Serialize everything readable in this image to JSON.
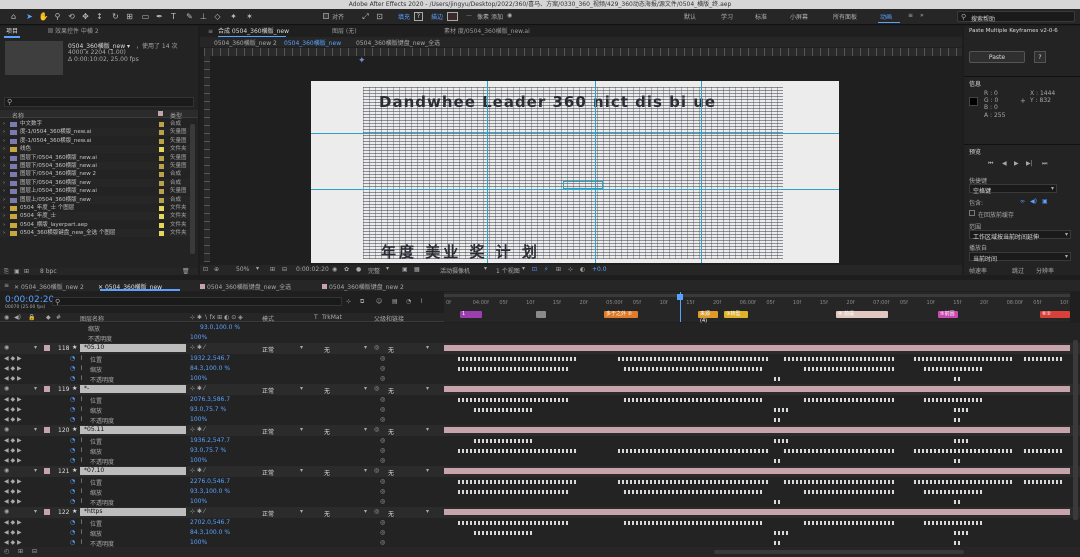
{
  "app": {
    "title": "Adobe After Effects 2020 - /Users/jingyu/Desktop/2022/360/喜马、方案/0330_360_视频/429_360动态海报/源文件/0504_横版_终.aep"
  },
  "toolbar": {
    "snap_label": "对齐",
    "fill_label": "填充",
    "stroke_label": "描边",
    "pixel_label": "像素",
    "add_label": "添加",
    "workspaces": [
      "默认",
      "学习",
      "标准",
      "小屏幕",
      "所有面板",
      "动画"
    ],
    "active_workspace": "动画",
    "search_placeholder": "搜索帮助"
  },
  "project": {
    "tabs": [
      "项目",
      "效果控件 中横 2"
    ],
    "item_name": "0504_360横版_new ▾",
    "used": "，使用了 14 次",
    "size": "4000 x 2204 (1.00)",
    "duration": "Δ 0:00:10:02, 25.00 fps",
    "search_placeholder": "",
    "col_name": "名称",
    "col_type": "类型",
    "items": [
      {
        "name": "中文数字",
        "type": "合成",
        "color": "#b9a24a"
      },
      {
        "name": "度-1/0504_360横版_new.ai",
        "type": "矢量图",
        "color": "#b9a24a"
      },
      {
        "name": "度-1/0504_360横版_new.ai",
        "type": "矢量图",
        "color": "#b9a24a"
      },
      {
        "name": "线色",
        "type": "文件夹",
        "color": "#e4d65a"
      },
      {
        "name": "图层下/0504_360横版_new.ai",
        "type": "矢量图",
        "color": "#b9a24a"
      },
      {
        "name": "图层下/0504_360横版_new.ai",
        "type": "矢量图",
        "color": "#b9a24a"
      },
      {
        "name": "图层下/0504_360横版_new 2",
        "type": "合成",
        "color": "#b9a24a"
      },
      {
        "name": "图层下/0504_360横版_new",
        "type": "合成",
        "color": "#b9a24a"
      },
      {
        "name": "图层上/0504_360横版_new.ai",
        "type": "矢量图",
        "color": "#b9a24a"
      },
      {
        "name": "图层上/0504_360横版_new",
        "type": "合成",
        "color": "#b9a24a"
      },
      {
        "name": "0504_年度_士 个图层",
        "type": "文件夹",
        "color": "#e4d65a"
      },
      {
        "name": "0504_年度_士",
        "type": "文件夹",
        "color": "#e4d65a"
      },
      {
        "name": "0504_横版_layerpart.aep",
        "type": "文件夹",
        "color": "#e4d65a"
      },
      {
        "name": "0504_360横版键盘_new_全选 个图层",
        "type": "文件夹",
        "color": "#e4d65a"
      }
    ],
    "bpc": "8 bpc"
  },
  "viewer": {
    "tabs": [
      "合成 0504_360横版_new",
      "图层 (无)",
      "素材 度/0504_360横版_new.ai"
    ],
    "sub_tabs": [
      "0504_360横版_new 2",
      "0504_360横版_new",
      "0504_360横版键盘_new_全选"
    ],
    "canvas_text_top": "Dandwhee Leader 360  nict dis bi ue",
    "canvas_text_bottom": "年度 美业 奖 计 划",
    "zoom": "50%",
    "timecode": "0:00:02:20",
    "quality": "完整",
    "camera": "活动摄像机",
    "views": "1 个视图",
    "exposure": "+0.0"
  },
  "right": {
    "script_title": "Paste Multiple Keyframes v2-0-6",
    "paste_button": "Paste",
    "help_button": "?",
    "info_title": "信息",
    "r": "R : 0",
    "g": "G : 0",
    "b": "B : 0",
    "a": "A : 255",
    "x": "X : 1444",
    "y": "Y : 832",
    "preview_title": "预览",
    "shortcut_label": "快捷键",
    "shortcut_value": "空格键",
    "include_label": "包含:",
    "cache_label": "在回放前缓存",
    "range_label": "范围",
    "range_value": "工作区域按当前时间延伸",
    "playfrom_label": "播放自",
    "playfrom_value": "当前时间",
    "framerate_label": "帧速率",
    "skip_label": "跳过",
    "resolution_label": "分辨率"
  },
  "timeline": {
    "tabs": [
      "0504_360横版_new 2",
      "0504_360横版_new",
      "0504_360横版键盘_new_全选",
      "0504_360横版键盘_new 2"
    ],
    "active_tab": "0504_360横版_new",
    "timecode": "0:00:02:20",
    "subcode": "00070 (25.00 fps)",
    "col_num": "#",
    "col_name": "图层名称",
    "col_mode": "模式",
    "col_t": "T",
    "col_trkmat": "TrkMat",
    "col_parent": "父级和链接",
    "mode_value": "正常",
    "trk_value": "无",
    "parent_value": "无",
    "prop_position": "位置",
    "prop_scale": "缩放",
    "prop_opacity": "不透明度",
    "layers": [
      {
        "num": "118",
        "name": "*05.10",
        "pos": "1932.2,546.7",
        "scale": "84.3,100.0 %",
        "opacity": "100%"
      },
      {
        "num": "119",
        "name": "*-",
        "pos": "2076.3,586.7",
        "scale": "93.0,75.7 %",
        "opacity": "100%"
      },
      {
        "num": "120",
        "name": "*05.11",
        "pos": "1936.2,547.7",
        "scale": "93.0,75.7 %",
        "opacity": "100%"
      },
      {
        "num": "121",
        "name": "*07.10",
        "pos": "2276.0,546.7",
        "scale": "93.3,100.0 %",
        "opacity": "100%"
      },
      {
        "num": "122",
        "name": "*https",
        "pos": "2702.0,546.7",
        "scale": "84.3,100.0 %",
        "opacity": "100%"
      }
    ],
    "top_prev_scale": "93.0,100.0 %",
    "top_prev_opacity": "100%",
    "ruler": [
      "0f",
      "04:00f",
      "05f",
      "10f",
      "15f",
      "20f",
      "05:00f",
      "05f",
      "10f",
      "15f",
      "20f",
      "06:00f",
      "05f",
      "10f",
      "15f",
      "20f",
      "07:00f",
      "05f",
      "10f",
      "15f",
      "20f",
      "08:00f",
      "05f",
      "10f"
    ],
    "markers": [
      {
        "label": "1",
        "color": "#9b3fb0"
      },
      {
        "label": "",
        "color": "#8a8a8a"
      },
      {
        "label": "多于之外 ②",
        "color": "#e07b2a"
      },
      {
        "label": "来源(4)",
        "color": "#e09a2a"
      },
      {
        "label": "③转型",
        "color": "#e0b22a"
      },
      {
        "label": "④ 前提",
        "color": "#e0c8c0"
      },
      {
        "label": "⑤前因",
        "color": "#c94ab0"
      },
      {
        "label": "⑥②",
        "color": "#d8403a"
      }
    ]
  },
  "colors": {
    "accent": "#5aa2ff",
    "layer_label": "#c7a4ac",
    "folder": "#e4d65a"
  }
}
